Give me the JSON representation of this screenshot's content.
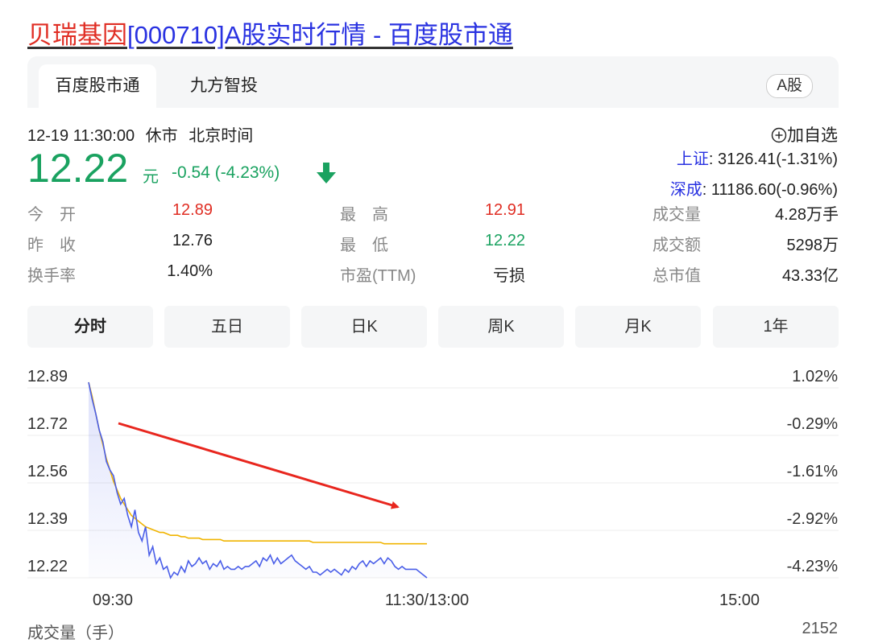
{
  "page_title": {
    "name": "贝瑞基因",
    "rest": "[000710]A股实时行情 - 百度股市通"
  },
  "tabs": {
    "active": "百度股市通",
    "other": "九方智投",
    "badge": "A股"
  },
  "quote": {
    "datetime": "12-19 11:30:00",
    "status": "休市",
    "timezone": "北京时间",
    "price": "12.22",
    "unit": "元",
    "change": "-0.54 (-4.23%)",
    "add_fav": "加自选",
    "indices": [
      {
        "name": "上证",
        "value": ": 3126.41(-1.31%)"
      },
      {
        "name": "深成",
        "value": ": 11186.60(-0.96%)"
      }
    ]
  },
  "stats": [
    [
      {
        "label": "今　开",
        "value": "12.89",
        "tone": "up"
      },
      {
        "label": "最　高",
        "value": "12.91",
        "tone": "up"
      },
      {
        "label": "成交量",
        "value": "4.28万手",
        "tone": "nv"
      }
    ],
    [
      {
        "label": "昨　收",
        "value": "12.76",
        "tone": "nv"
      },
      {
        "label": "最　低",
        "value": "12.22",
        "tone": "dn"
      },
      {
        "label": "成交额",
        "value": "5298万",
        "tone": "nv"
      }
    ],
    [
      {
        "label": "换手率",
        "value": "1.40%",
        "tone": "nv"
      },
      {
        "label": "市盈(TTM)",
        "value": "亏损",
        "tone": "nv"
      },
      {
        "label": "总市值",
        "value": "43.33亿",
        "tone": "nv"
      }
    ]
  ],
  "chart_tabs": [
    "分时",
    "五日",
    "日K",
    "周K",
    "月K",
    "1年"
  ],
  "chart_data": {
    "type": "line",
    "y_left": [
      "12.89",
      "12.72",
      "12.56",
      "12.39",
      "12.22"
    ],
    "y_right": [
      "1.02%",
      "-0.29%",
      "-1.61%",
      "-2.92%",
      "-4.23%"
    ],
    "x_labels": [
      "09:30",
      "11:30/13:00",
      "15:00"
    ],
    "ylim": [
      12.22,
      12.89
    ],
    "colors": {
      "price": "#4a5ee8",
      "avg": "#f0b400",
      "arrow": "#e8261e"
    },
    "series": [
      {
        "values": [
          12.91,
          12.85,
          12.8,
          12.74,
          12.7,
          12.63,
          12.6,
          12.58,
          12.52,
          12.48,
          12.5,
          12.44,
          12.4,
          12.46,
          12.38,
          12.35,
          12.4,
          12.3,
          12.33,
          12.27,
          12.29,
          12.25,
          12.26,
          12.22,
          12.24,
          12.23,
          12.26,
          12.24,
          12.28,
          12.26,
          12.27,
          12.29,
          12.27,
          12.28,
          12.25,
          12.27,
          12.26,
          12.28,
          12.25,
          12.26,
          12.25,
          12.25,
          12.26,
          12.25,
          12.26,
          12.26,
          12.27,
          12.28,
          12.26,
          12.29,
          12.28,
          12.3,
          12.27,
          12.29,
          12.27,
          12.28,
          12.29,
          12.3,
          12.28,
          12.27,
          12.26,
          12.25,
          12.26,
          12.24,
          12.24,
          12.23,
          12.24,
          12.25,
          12.24,
          12.25,
          12.24,
          12.23,
          12.25,
          12.24,
          12.26,
          12.25,
          12.27,
          12.28,
          12.26,
          12.28,
          12.27,
          12.28,
          12.29,
          12.27,
          12.29,
          12.28,
          12.26,
          12.25,
          12.26,
          12.25,
          12.25,
          12.25,
          12.25,
          12.24,
          12.23,
          12.22
        ]
      },
      {
        "values": [
          12.91,
          12.86,
          12.8,
          12.74,
          12.69,
          12.64,
          12.6,
          12.56,
          12.53,
          12.5,
          12.48,
          12.46,
          12.44,
          12.43,
          12.42,
          12.41,
          12.4,
          12.395,
          12.39,
          12.385,
          12.38,
          12.38,
          12.375,
          12.37,
          12.37,
          12.37,
          12.365,
          12.365,
          12.36,
          12.36,
          12.36,
          12.36,
          12.355,
          12.355,
          12.355,
          12.355,
          12.355,
          12.355,
          12.35,
          12.35,
          12.35,
          12.35,
          12.35,
          12.35,
          12.35,
          12.35,
          12.35,
          12.35,
          12.35,
          12.35,
          12.35,
          12.35,
          12.35,
          12.35,
          12.35,
          12.35,
          12.35,
          12.35,
          12.35,
          12.35,
          12.35,
          12.35,
          12.35,
          12.345,
          12.345,
          12.345,
          12.345,
          12.345,
          12.345,
          12.345,
          12.345,
          12.345,
          12.345,
          12.345,
          12.345,
          12.345,
          12.345,
          12.345,
          12.345,
          12.345,
          12.345,
          12.345,
          12.345,
          12.34,
          12.34,
          12.34,
          12.34,
          12.34,
          12.34,
          12.34,
          12.34,
          12.34,
          12.34,
          12.34,
          12.34,
          12.34
        ]
      }
    ]
  },
  "volume": {
    "label": "成交量（手）",
    "max": "2152"
  }
}
